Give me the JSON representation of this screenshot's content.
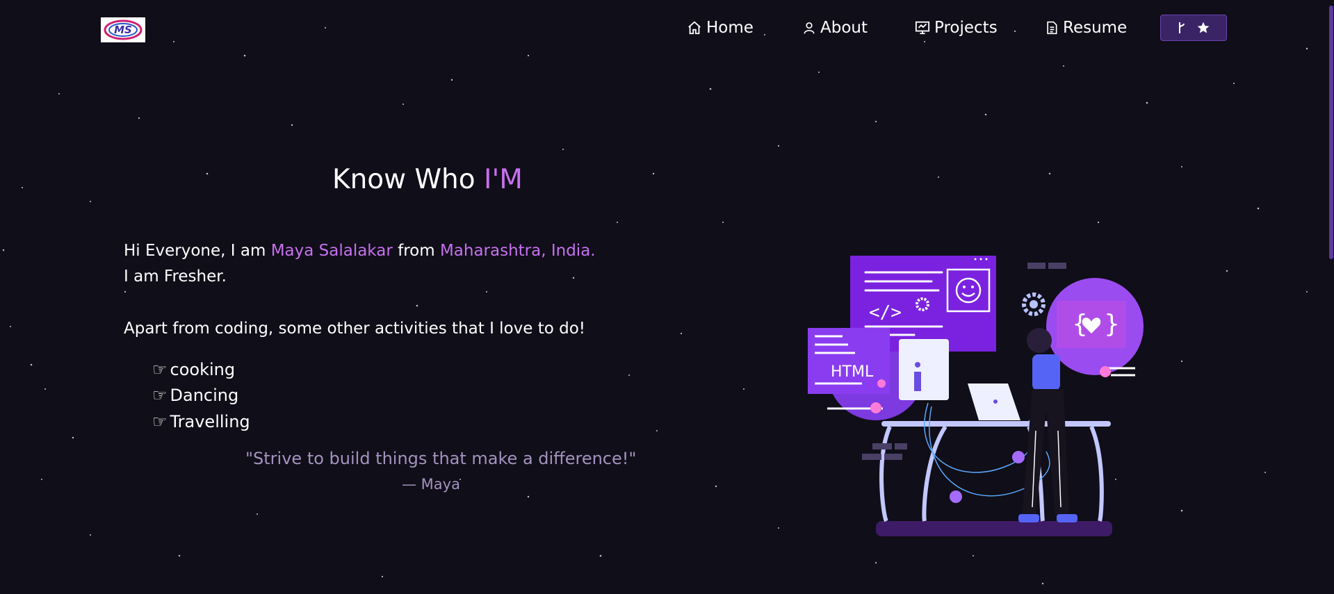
{
  "colors": {
    "background": "#100e18",
    "accent": "#c770f0",
    "quote": "#a393c0",
    "button_bg": "#3b2466",
    "scroll_thumb": "#5e3b9a"
  },
  "logo": {
    "text": "MS"
  },
  "nav": {
    "items": [
      {
        "label": "Home",
        "icon": "home-icon"
      },
      {
        "label": "About",
        "icon": "user-icon"
      },
      {
        "label": "Projects",
        "icon": "projects-icon"
      },
      {
        "label": "Resume",
        "icon": "document-icon"
      }
    ],
    "fork_button": {
      "icons": [
        "git-fork-icon",
        "star-icon"
      ]
    }
  },
  "about": {
    "heading_prefix": "Know Who ",
    "heading_accent": "I'M",
    "intro_1": "Hi Everyone, I am ",
    "name": "Maya Salalakar",
    "intro_2": " from ",
    "location": "Maharashtra, India.",
    "status": "I am Fresher.",
    "activities_intro": "Apart from coding, some other activities that I love to do!",
    "activities": [
      "cooking",
      "Dancing",
      "Travelling"
    ],
    "activity_icon": "hand-pointing-icon",
    "quote": "\"Strive to build things that make a difference!\"",
    "author": "— Maya"
  },
  "illustration": {
    "panel_text": "HTML",
    "icon": "developer-illustration"
  }
}
